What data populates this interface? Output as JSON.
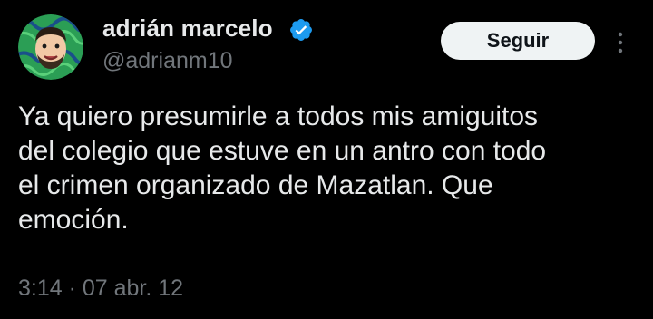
{
  "author": {
    "display_name": "adrián marcelo",
    "handle": "@adrianm10",
    "verified": true,
    "verified_badge_color": "#1d9bf0"
  },
  "actions": {
    "follow_label": "Seguir"
  },
  "tweet": {
    "text": "Ya quiero presumirle a todos mis amiguitos\ndel colegio que estuve en un antro con todo\nel crimen organizado de Mazatlan. Que\nemoción.",
    "timestamp": "3:14 · 07 abr. 12"
  },
  "icons": {
    "avatar": "avatar-illustration",
    "verified": "verified-badge-icon",
    "more": "more-options-icon"
  },
  "colors": {
    "background": "#000000",
    "text_primary": "#e7e9ea",
    "text_secondary": "#71767b",
    "button_bg": "#eff3f4",
    "avatar_green": "#2fae5a"
  }
}
